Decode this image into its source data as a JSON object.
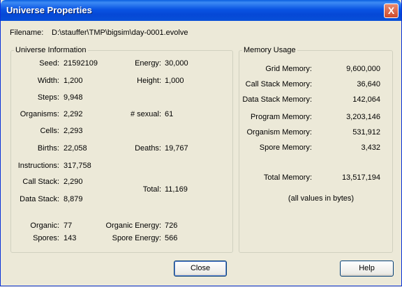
{
  "window": {
    "title": "Universe Properties",
    "close_glyph": "X"
  },
  "filename": {
    "label": "Filename:",
    "value": "D:\\stauffer\\TMP\\bigsim\\day-0001.evolve"
  },
  "universe": {
    "title": "Universe Information",
    "seed_label": "Seed:",
    "seed": "21592109",
    "energy_label": "Energy:",
    "energy": "30,000",
    "width_label": "Width:",
    "width": "1,200",
    "height_label": "Height:",
    "height": "1,000",
    "steps_label": "Steps:",
    "steps": "9,948",
    "organisms_label": "Organisms:",
    "organisms": "2,292",
    "sexual_label": "# sexual:",
    "sexual": "61",
    "cells_label": "Cells:",
    "cells": "2,293",
    "births_label": "Births:",
    "births": "22,058",
    "deaths_label": "Deaths:",
    "deaths": "19,767",
    "instructions_label": "Instructions:",
    "instructions": "317,758",
    "callstack_label": "Call Stack:",
    "callstack": "2,290",
    "total_label": "Total:",
    "total": "11,169",
    "datastack_label": "Data Stack:",
    "datastack": "8,879",
    "organic_label": "Organic:",
    "organic": "77",
    "organic_energy_label": "Organic Energy:",
    "organic_energy": "726",
    "spores_label": "Spores:",
    "spores": "143",
    "spore_energy_label": "Spore Energy:",
    "spore_energy": "566"
  },
  "memory": {
    "title": "Memory Usage",
    "grid_label": "Grid Memory:",
    "grid": "9,600,000",
    "callstack_label": "Call Stack Memory:",
    "callstack": "36,640",
    "datastack_label": "Data Stack Memory:",
    "datastack": "142,064",
    "program_label": "Program Memory:",
    "program": "3,203,146",
    "organism_label": "Organism Memory:",
    "organism": "531,912",
    "spore_label": "Spore Memory:",
    "spore": "3,432",
    "total_label": "Total Memory:",
    "total": "13,517,194",
    "note": "(all values in bytes)"
  },
  "buttons": {
    "close": "Close",
    "help": "Help"
  }
}
